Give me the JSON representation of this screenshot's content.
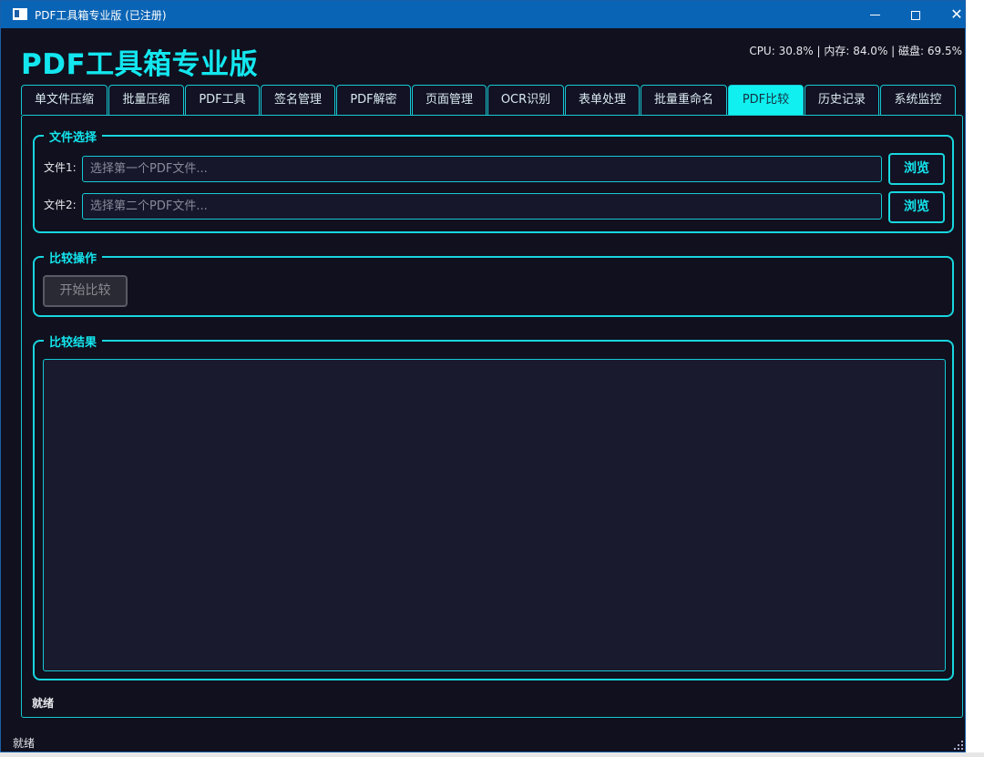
{
  "window": {
    "title": "PDF工具箱专业版 (已注册)",
    "controls": {
      "minimize": "",
      "maximize": "",
      "close": "✕"
    }
  },
  "header": {
    "app_title": "PDF工具箱专业版",
    "stats": "CPU: 30.8% | 内存: 84.0% | 磁盘: 69.5%"
  },
  "tabs": [
    {
      "label": "单文件压缩"
    },
    {
      "label": "批量压缩"
    },
    {
      "label": "PDF工具"
    },
    {
      "label": "签名管理"
    },
    {
      "label": "PDF解密"
    },
    {
      "label": "页面管理"
    },
    {
      "label": "OCR识别"
    },
    {
      "label": "表单处理"
    },
    {
      "label": "批量重命名"
    },
    {
      "label": "PDF比较",
      "active": true
    },
    {
      "label": "历史记录"
    },
    {
      "label": "系统监控"
    }
  ],
  "file_selection": {
    "legend": "文件选择",
    "file1": {
      "label": "文件1:",
      "value": "",
      "placeholder": "选择第一个PDF文件...",
      "browse": "浏览"
    },
    "file2": {
      "label": "文件2:",
      "value": "",
      "placeholder": "选择第二个PDF文件...",
      "browse": "浏览"
    }
  },
  "compare_ops": {
    "legend": "比较操作",
    "start_button": "开始比较"
  },
  "compare_results": {
    "legend": "比较结果",
    "text": ""
  },
  "status": {
    "panel": "就绪",
    "bottom": "就绪"
  },
  "colors": {
    "accent": "#13e6ee",
    "background": "#10101e",
    "titlebar": "#0a64b5"
  }
}
